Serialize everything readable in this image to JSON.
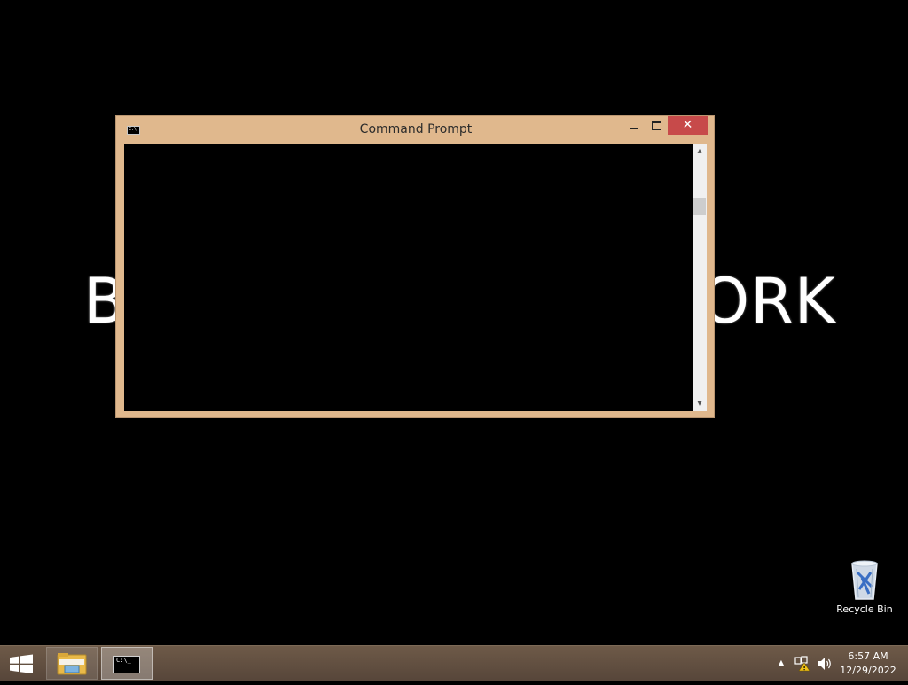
{
  "desktop": {
    "wallpaper_text_left": "B",
    "wallpaper_text_right": "ORK",
    "recycle_bin_label": "Recycle Bin"
  },
  "cmd_window": {
    "title": "Command Prompt",
    "icon_text": "C:\\",
    "close_symbol": "✕",
    "scroll_up_symbol": "▴",
    "scroll_down_symbol": "▾",
    "frame_color": "#e0b88d",
    "close_color": "#c74a4a"
  },
  "taskbar": {
    "cmd_icon_text": "C:\\_",
    "tray_chevron": "▲",
    "clock_time": "6:57 AM",
    "clock_date": "12/29/2022",
    "color": "#5f4d3f"
  },
  "icons": {
    "start": "windows-logo-icon",
    "explorer": "folder-icon",
    "cmd": "command-prompt-icon",
    "network": "network-warning-icon",
    "volume": "speaker-icon",
    "recycle_bin": "recycle-bin-icon"
  }
}
